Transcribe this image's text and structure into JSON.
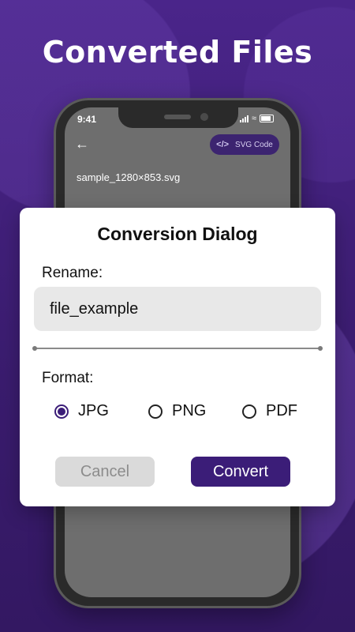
{
  "headline": "Converted Files",
  "phone": {
    "status_time": "9:41",
    "header": {
      "svg_code_label": "SVG Code",
      "svg_code_icon": "</>"
    },
    "filename": "sample_1280×853.svg"
  },
  "dialog": {
    "title": "Conversion Dialog",
    "rename_label": "Rename:",
    "rename_value": "file_example",
    "format_label": "Format:",
    "formats": [
      {
        "label": "JPG",
        "checked": true
      },
      {
        "label": "PNG",
        "checked": false
      },
      {
        "label": "PDF",
        "checked": false
      }
    ],
    "cancel_label": "Cancel",
    "convert_label": "Convert"
  },
  "colors": {
    "accent": "#3b1d78",
    "background": "#3f1f76",
    "dialog": "#ffffff"
  }
}
